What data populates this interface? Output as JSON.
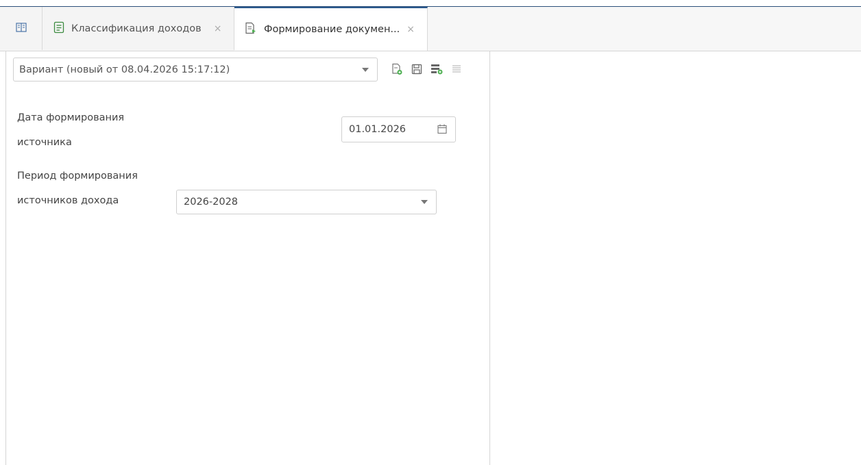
{
  "tabs": [
    {
      "label": "",
      "icon": "book-icon"
    },
    {
      "label": "Классификация доходов",
      "icon": "list-document-icon",
      "close": "×"
    },
    {
      "label": "Формирование докумен...",
      "icon": "document-arrow-icon",
      "close": "×",
      "active": true
    }
  ],
  "variant": {
    "value": "Вариант (новый от 08.04.2026 15:17:12)",
    "toolbar": [
      "new-variant-icon",
      "save-icon",
      "add-list-icon",
      "list-icon"
    ]
  },
  "form": {
    "date_label": "Дата формирования источника",
    "date_value": "01.01.2026",
    "period_label": "Период формирования источников дохода",
    "period_value": "2026-2028"
  },
  "colors": {
    "accent": "#2e5b8e",
    "icon_green": "#4caf50",
    "border": "#cfcfcf"
  }
}
